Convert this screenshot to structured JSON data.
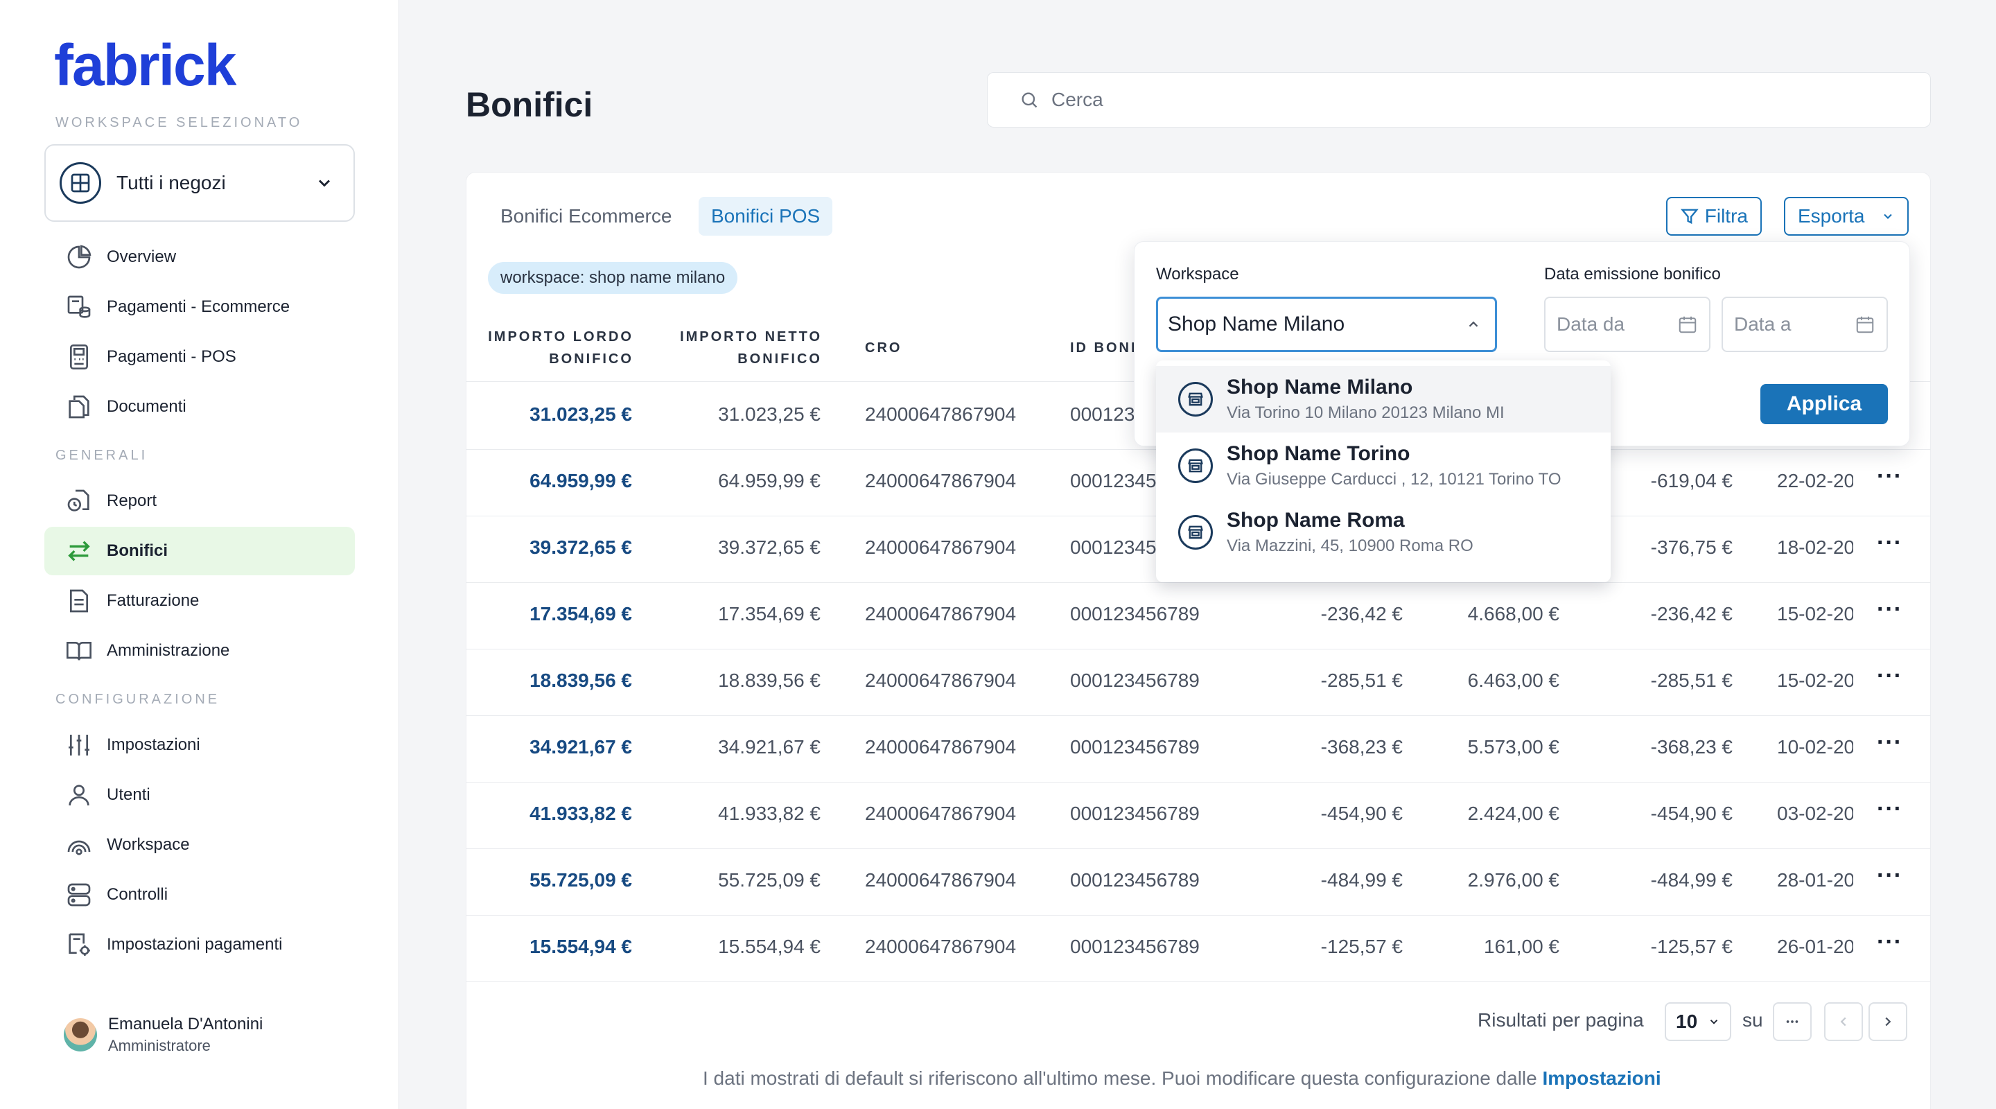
{
  "app": {
    "logo": "fabrick"
  },
  "sidebar": {
    "workspace_label": "WORKSPACE SELEZIONATO",
    "workspace_value": "Tutti i negozi",
    "items_top": [
      {
        "label": "Overview",
        "icon": "pie-chart-icon"
      },
      {
        "label": "Pagamenti - Ecommerce",
        "icon": "coins-icon"
      },
      {
        "label": "Pagamenti - POS",
        "icon": "pos-terminal-icon"
      },
      {
        "label": "Documenti",
        "icon": "documents-icon"
      }
    ],
    "section_generali": "GENERALI",
    "items_generali": [
      {
        "label": "Report",
        "icon": "report-clock-icon"
      },
      {
        "label": "Bonifici",
        "icon": "transfer-arrows-icon",
        "active": true
      },
      {
        "label": "Fatturazione",
        "icon": "invoice-icon"
      },
      {
        "label": "Amministrazione",
        "icon": "book-icon"
      }
    ],
    "section_config": "CONFIGURAZIONE",
    "items_config": [
      {
        "label": "Impostazioni",
        "icon": "sliders-icon"
      },
      {
        "label": "Utenti",
        "icon": "user-icon"
      },
      {
        "label": "Workspace",
        "icon": "workspace-icon"
      },
      {
        "label": "Controlli",
        "icon": "server-icon"
      },
      {
        "label": "Impostazioni pagamenti",
        "icon": "settings-doc-icon"
      }
    ],
    "user": {
      "name": "Emanuela D'Antonini",
      "role": "Amministratore"
    }
  },
  "header": {
    "title": "Bonifici",
    "search_placeholder": "Cerca"
  },
  "tabs": {
    "ecommerce": "Bonifici Ecommerce",
    "pos": "Bonifici POS"
  },
  "toolbar": {
    "filter": "Filtra",
    "export": "Esporta"
  },
  "active_filter_chip": "workspace: shop name milano",
  "table": {
    "headers": {
      "lordo_1": "IMPORTO LORDO",
      "lordo_2": "BONIFICO",
      "netto_1": "IMPORTO NETTO",
      "netto_2": "BONIFICO",
      "cro": "CRO",
      "id": "ID BONI"
    },
    "rows": [
      {
        "lordo": "31.023,25 €",
        "netto": "31.023,25 €",
        "cro": "24000647867904",
        "id": "000123",
        "c5": "",
        "c6": "",
        "c7": "",
        "date": ""
      },
      {
        "lordo": "64.959,99 €",
        "netto": "64.959,99 €",
        "cro": "24000647867904",
        "id": "00012345",
        "c5": "",
        "c6": "",
        "c7": "-619,04 €",
        "date": "22-02-20"
      },
      {
        "lordo": "39.372,65 €",
        "netto": "39.372,65 €",
        "cro": "24000647867904",
        "id": "00012345",
        "c5": "",
        "c6": "",
        "c7": "-376,75 €",
        "date": "18-02-20"
      },
      {
        "lordo": "17.354,69 €",
        "netto": "17.354,69 €",
        "cro": "24000647867904",
        "id": "000123456789",
        "c5": "-236,42 €",
        "c6": "4.668,00 €",
        "c7": "-236,42 €",
        "date": "15-02-20"
      },
      {
        "lordo": "18.839,56 €",
        "netto": "18.839,56 €",
        "cro": "24000647867904",
        "id": "000123456789",
        "c5": "-285,51 €",
        "c6": "6.463,00 €",
        "c7": "-285,51 €",
        "date": "15-02-20"
      },
      {
        "lordo": "34.921,67 €",
        "netto": "34.921,67 €",
        "cro": "24000647867904",
        "id": "000123456789",
        "c5": "-368,23 €",
        "c6": "5.573,00 €",
        "c7": "-368,23 €",
        "date": "10-02-20"
      },
      {
        "lordo": "41.933,82 €",
        "netto": "41.933,82 €",
        "cro": "24000647867904",
        "id": "000123456789",
        "c5": "-454,90 €",
        "c6": "2.424,00 €",
        "c7": "-454,90 €",
        "date": "03-02-20"
      },
      {
        "lordo": "55.725,09 €",
        "netto": "55.725,09 €",
        "cro": "24000647867904",
        "id": "000123456789",
        "c5": "-484,99 €",
        "c6": "2.976,00 €",
        "c7": "-484,99 €",
        "date": "28-01-20"
      },
      {
        "lordo": "15.554,94 €",
        "netto": "15.554,94 €",
        "cro": "24000647867904",
        "id": "000123456789",
        "c5": "-125,57 €",
        "c6": "161,00 €",
        "c7": "-125,57 €",
        "date": "26-01-20"
      }
    ]
  },
  "pagination": {
    "label": "Risultati per pagina",
    "per_page": "10",
    "su": "su"
  },
  "footer_note": {
    "text": "I dati mostrati di default si riferiscono all'ultimo mese. Puoi modificare questa configurazione dalle ",
    "link": "Impostazioni"
  },
  "filter_panel": {
    "workspace_label": "Workspace",
    "workspace_value": "Shop Name Milano",
    "date_label": "Data emissione bonifico",
    "date_from_placeholder": "Data da",
    "date_to_placeholder": "Data a",
    "apply": "Applica",
    "options": [
      {
        "name": "Shop Name Milano",
        "address": "Via Torino 10 Milano 20123 Milano MI"
      },
      {
        "name": "Shop Name Torino",
        "address": "Via Giuseppe Carducci , 12, 10121 Torino TO"
      },
      {
        "name": "Shop Name Roma",
        "address": "Via Mazzini, 45, 10900 Roma RO"
      }
    ]
  },
  "colors": {
    "brand": "#1f3fd8",
    "accent": "#1a73b8",
    "active_nav": "#e8f8e6",
    "amount": "#174a82"
  }
}
